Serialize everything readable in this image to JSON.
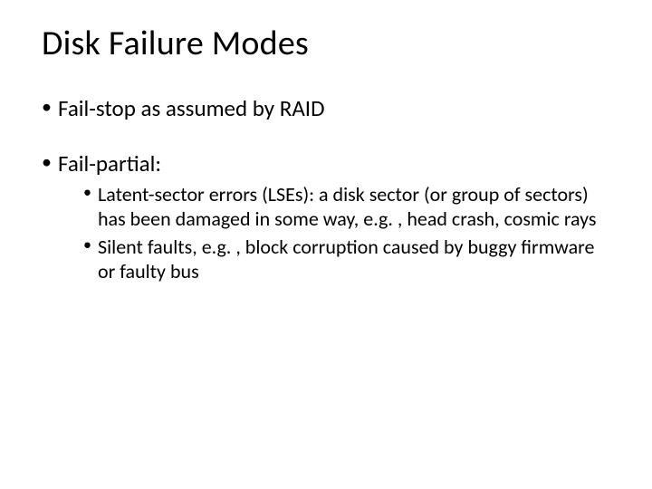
{
  "title": "Disk Failure Modes",
  "bullets": [
    {
      "text": "Fail-stop as assumed by RAID"
    },
    {
      "text": "Fail-partial:",
      "sub": [
        "Latent-sector errors (LSEs): a disk sector (or group of sectors) has been damaged in some way, e.g. , head crash, cosmic rays",
        "Silent faults, e.g. , block corruption caused by buggy firmware or faulty bus"
      ]
    }
  ]
}
